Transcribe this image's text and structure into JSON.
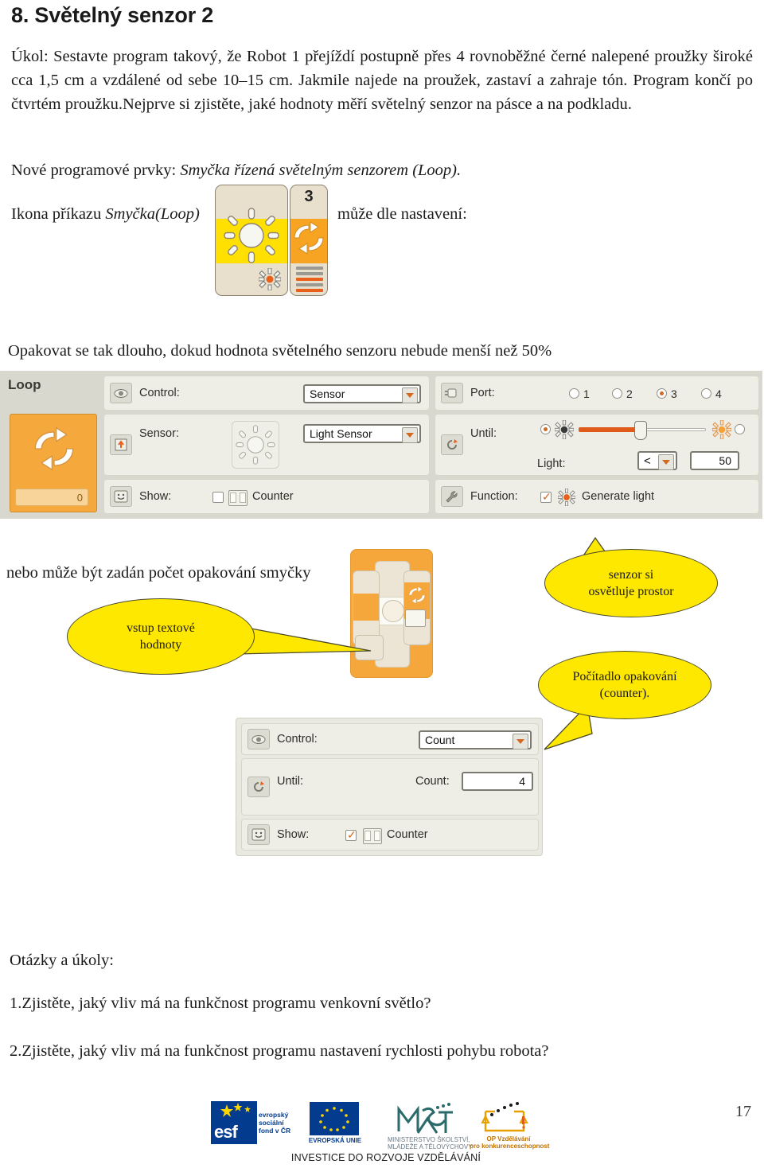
{
  "document": {
    "title": "8. Světelný senzor 2",
    "page_number": "17",
    "intro_paragraph": "Úkol: Sestavte program takový, že Robot 1 přejíždí postupně přes 4 rovnoběžné černé nalepené proužky široké cca 1,5 cm a vzdálené od sebe 10–15 cm. Jakmile najede na proužek, zastaví a zahraje tón. Program končí po čtvrtém proužku.Nejprve si zjistěte, jaké hodnoty měří světelný senzor na pásce a na podkladu.",
    "new_elements_prefix": "Nové programové prvky: ",
    "new_elements_emphasis": "Smyčka řízená světelným senzorem (Loop).",
    "icon_line_prefix": "Ikona příkazu ",
    "icon_line_emphasis": "Smyčka(Loop)",
    "icon_line_suffix": "může dle nastavení:",
    "repeat_caption": "Opakovat se tak dlouho, dokud hodnota světelného senzoru nebude menší než 50%",
    "count_caption": "nebo může být zadán počet opakování smyčky",
    "questions_heading": "Otázky a úkoly:",
    "question_1": "1.Zjistěte, jaký vliv má na funkčnost programu venkovní světlo?",
    "question_2": "2.Zjistěte, jaký vliv má na funkčnost programu nastavení rychlosti pohybu robota?"
  },
  "palette_icon": {
    "loop_count": "3",
    "light_tile_name": "light-sensor-tile",
    "loop_tile_name": "loop-tile"
  },
  "loop_panel": {
    "block_title": "Loop",
    "block_counter_value": "0",
    "rows": {
      "control": {
        "label": "Control:",
        "value": "Sensor"
      },
      "sensor": {
        "label": "Sensor:",
        "value": "Light Sensor"
      },
      "show": {
        "label": "Show:",
        "checkbox_label": "Counter",
        "checked": false
      },
      "port": {
        "label": "Port:",
        "options": [
          "1",
          "2",
          "3",
          "4"
        ],
        "selected": "3"
      },
      "until": {
        "label": "Until:",
        "light_label": "Light:",
        "comparator": "<",
        "threshold": "50",
        "slider_percent": 50
      },
      "function": {
        "label": "Function:",
        "checkbox_label": "Generate light",
        "checked": true
      }
    }
  },
  "count_panel": {
    "rows": {
      "control": {
        "label": "Control:",
        "value": "Count"
      },
      "until": {
        "label": "Until:",
        "count_label": "Count:",
        "count_value": "4"
      },
      "show": {
        "label": "Show:",
        "checkbox_label": "Counter",
        "checked": true
      }
    }
  },
  "callouts": {
    "text_input": "vstup textové\nhodnoty",
    "text_input_line1": "vstup textové",
    "text_input_line2": "hodnoty",
    "sensor_light_line1": "senzor si",
    "sensor_light_line2": "osvětluje prostor",
    "counter_line1": "Počítadlo opakování",
    "counter_line2": "(counter)."
  },
  "footer": {
    "esf_line1": "evropský",
    "esf_line2": "sociální",
    "esf_line3": "fond v ČR",
    "esf_word": "esf",
    "eu_caption": "EVROPSKÁ UNIE",
    "msmt_caption_line1": "MINISTERSTVO ŠKOLSTVÍ,",
    "msmt_caption_line2": "MLÁDEŽE A TĚLOVÝCHOVY",
    "msmt_mark": "MŠMT",
    "op_caption_line1": "OP Vzdělávání",
    "op_caption_line2": "pro konkurenceschopnost",
    "investice": "INVESTICE DO ROZVOJE VZDĚLÁVÁNÍ"
  },
  "colors": {
    "lego_orange": "#f5a73b",
    "lego_yellow": "#ffe000",
    "callout_yellow": "#ffe800",
    "accent_orange": "#d2691e",
    "panel_gray": "#e9e9e0",
    "eu_blue": "#033b8f"
  }
}
